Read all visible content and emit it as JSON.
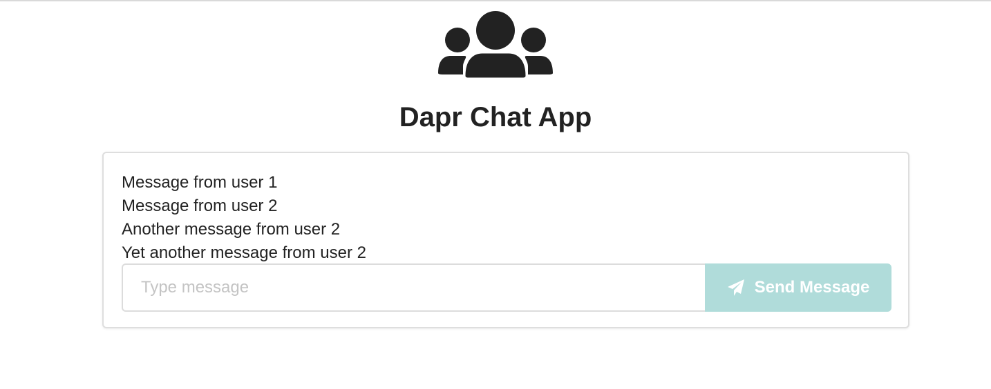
{
  "app": {
    "title": "Dapr Chat App",
    "logo_icon": "users-group-icon"
  },
  "messages": [
    "Message from user 1",
    "Message from user 2",
    "Another message from user 2",
    "Yet another message from user 2"
  ],
  "composer": {
    "placeholder": "Type message",
    "value": "",
    "send_label": "Send Message",
    "send_icon": "paper-plane-icon"
  },
  "colors": {
    "text": "#222222",
    "send_button_bg": "#b0dcda",
    "send_button_text": "#ffffff",
    "border": "#dcdcdc"
  }
}
